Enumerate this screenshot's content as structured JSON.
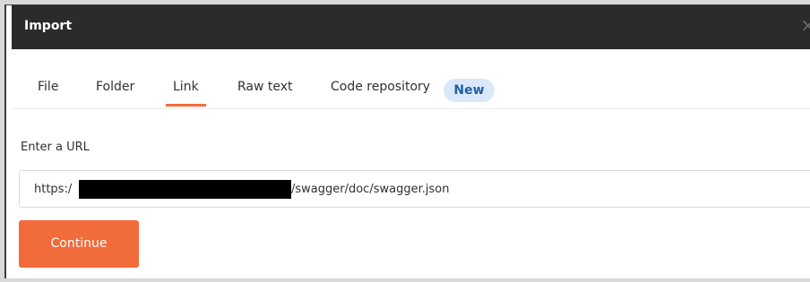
{
  "dialog": {
    "title": "Import",
    "close_glyph": "×"
  },
  "tabs": [
    {
      "label": "File",
      "active": false
    },
    {
      "label": "Folder",
      "active": false
    },
    {
      "label": "Link",
      "active": true
    },
    {
      "label": "Raw text",
      "active": false
    },
    {
      "label": "Code repository",
      "active": false
    }
  ],
  "badge": {
    "label": "New"
  },
  "url": {
    "label": "Enter a URL",
    "prefix": "https:/",
    "suffix": "/swagger/doc/swagger.json"
  },
  "continue_label": "Continue",
  "colors": {
    "accent": "#f26b3a",
    "titlebar": "#2b2b2b",
    "badge_bg": "#d9e9fa",
    "badge_text": "#1f5fa8"
  },
  "icons": {
    "close": "close-icon"
  }
}
